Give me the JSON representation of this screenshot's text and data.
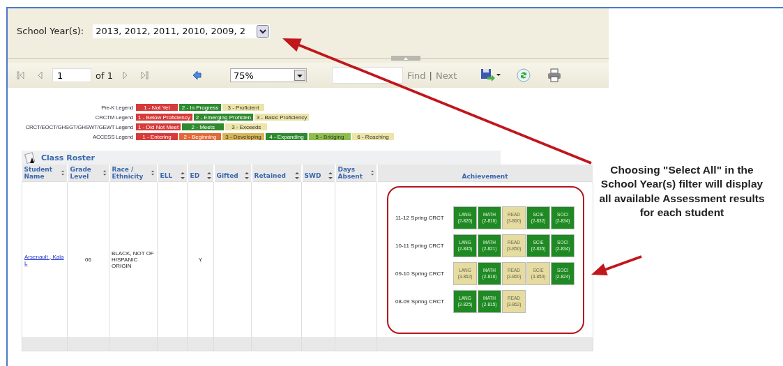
{
  "parameters": {
    "label": "School Year(s):",
    "value": "2013, 2012, 2011, 2010, 2009, 2"
  },
  "toolbar": {
    "nav": [
      {
        "kind": "first",
        "disabled": true
      },
      {
        "kind": "prev",
        "disabled": true
      }
    ],
    "page": "1",
    "of": "of 1",
    "nav2": [
      {
        "kind": "next",
        "disabled": true
      },
      {
        "kind": "last",
        "disabled": true
      }
    ],
    "zoom": "75%",
    "find": "Find",
    "sep": "|",
    "next": "Next"
  },
  "legends": [
    {
      "label": "Pre-K Legend",
      "items": [
        {
          "text": "1 - Not Yet",
          "color": "#d63a3a"
        },
        {
          "text": "2 - In Progress",
          "color": "#2f8a2f"
        },
        {
          "text": "3 - Proficient",
          "color": "#ece4a8"
        }
      ]
    },
    {
      "label": "CRCTM Legend",
      "items": [
        {
          "text": "1 - Below Proficiency",
          "color": "#d63a3a"
        },
        {
          "text": "2 - Emerging Proficien",
          "color": "#2f8a2f"
        },
        {
          "text": "3 - Basic Proficiency",
          "color": "#ece4a8"
        }
      ]
    },
    {
      "label": "CRCT/EOCT/GHSGT/GHSWT/GEWT Legend",
      "items": [
        {
          "text": "1 - Did Not Meet",
          "color": "#d63a3a"
        },
        {
          "text": "2 - Meets",
          "color": "#2f8a2f"
        },
        {
          "text": "3 - Exceeds",
          "color": "#ece4a8"
        }
      ]
    },
    {
      "label": "ACCESS Legend",
      "items": [
        {
          "text": "1 - Entering",
          "color": "#d63a3a"
        },
        {
          "text": "2 - Beginning",
          "color": "#e06a38"
        },
        {
          "text": "3 - Developing",
          "color": "#d8b458"
        },
        {
          "text": "4 - Expanding",
          "color": "#2f8a2f"
        },
        {
          "text": "5 - Bridging",
          "color": "#8cc04c"
        },
        {
          "text": "6 - Reaching",
          "color": "#ece4a8"
        }
      ]
    }
  ],
  "roster": {
    "title": "Class Roster",
    "columns": [
      {
        "label": "Student Name",
        "sortable": true
      },
      {
        "label": "Grade Level",
        "sortable": true
      },
      {
        "label": "Race / Ethnicity",
        "sortable": true
      },
      {
        "label": "ELL",
        "sortable": true
      },
      {
        "label": "ED",
        "sortable": true
      },
      {
        "label": "Gifted",
        "sortable": true
      },
      {
        "label": "Retained",
        "sortable": true
      },
      {
        "label": "SWD",
        "sortable": true
      },
      {
        "label": "Days Absent",
        "sortable": true
      },
      {
        "label": "Achievement",
        "sortable": false
      }
    ],
    "rows": [
      {
        "student": "Arsenault , Kala L",
        "grade": "06",
        "race": "BLACK, NOT OF HISPANIC ORIGIN",
        "ell": "",
        "ed": "Y",
        "gifted": "",
        "retained": "",
        "swd": "",
        "absent": "",
        "achievement": [
          {
            "label": "11-12 Spring CRCT",
            "scores": [
              {
                "subject": "LANG",
                "score": "(2-826)",
                "color": "#1f8a24"
              },
              {
                "subject": "MATH",
                "score": "(2-816)",
                "color": "#1f8a24"
              },
              {
                "subject": "READ",
                "score": "(3-860)",
                "color": "#e6dca0"
              },
              {
                "subject": "SCIE",
                "score": "(2-832)",
                "color": "#1f8a24"
              },
              {
                "subject": "SOCI",
                "score": "(2-834)",
                "color": "#1f8a24"
              }
            ]
          },
          {
            "label": "10-11 Spring CRCT",
            "scores": [
              {
                "subject": "LANG",
                "score": "(2-845)",
                "color": "#1f8a24"
              },
              {
                "subject": "MATH",
                "score": "(2-821)",
                "color": "#1f8a24"
              },
              {
                "subject": "READ",
                "score": "(3-850)",
                "color": "#e6dca0"
              },
              {
                "subject": "SCIE",
                "score": "(2-835)",
                "color": "#1f8a24"
              },
              {
                "subject": "SOCI",
                "score": "(2-834)",
                "color": "#1f8a24"
              }
            ]
          },
          {
            "label": "09-10 Spring CRCT",
            "scores": [
              {
                "subject": "LANG",
                "score": "(3-862)",
                "color": "#e6dca0"
              },
              {
                "subject": "MATH",
                "score": "(2-816)",
                "color": "#1f8a24"
              },
              {
                "subject": "READ",
                "score": "(3-860)",
                "color": "#e6dca0"
              },
              {
                "subject": "SCIE",
                "score": "(3-850)",
                "color": "#e6dca0"
              },
              {
                "subject": "SOCI",
                "score": "(2-824)",
                "color": "#1f8a24"
              }
            ]
          },
          {
            "label": "08-09 Spring CRCT",
            "scores": [
              {
                "subject": "LANG",
                "score": "(2-825)",
                "color": "#1f8a24"
              },
              {
                "subject": "MATH",
                "score": "(2-815)",
                "color": "#1f8a24"
              },
              {
                "subject": "READ",
                "score": "(3-862)",
                "color": "#e6dca0"
              }
            ]
          }
        ]
      }
    ]
  },
  "callout": "Choosing \"Select All\" in the School Year(s) filter will display all available Assessment results for each student"
}
